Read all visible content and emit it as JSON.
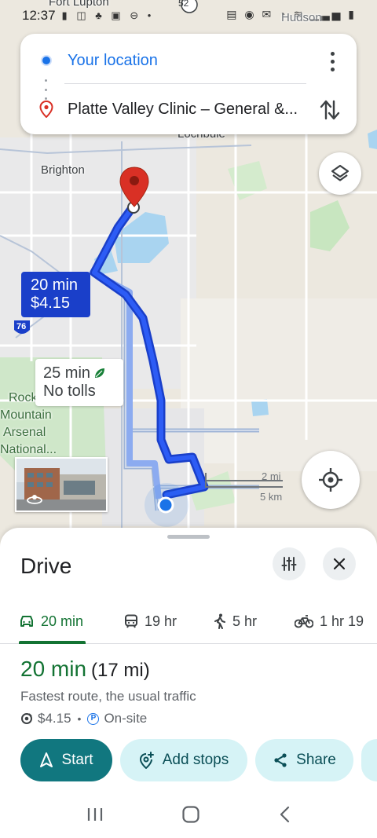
{
  "status_bar": {
    "time": "12:37",
    "carrier_text": "Hudson"
  },
  "search": {
    "origin": "Your location",
    "destination": "Platte Valley Clinic – General &..."
  },
  "map": {
    "labels": {
      "fort_lupton": "Fort Lupton",
      "lochbuie": "Lochbuie",
      "brighton": "Brighton",
      "rocky_mountain_arsenal": [
        "Rocky",
        "Mountain",
        "Arsenal",
        "National..."
      ],
      "highway_76": "76",
      "highway_52": "52",
      "hudson": "Hudson"
    },
    "primary_route": {
      "time": "20 min",
      "cost": "$4.15"
    },
    "alternate_route": {
      "time": "25 min",
      "note": "No tolls"
    },
    "scale": {
      "miles": "2 mi",
      "km": "5 km"
    }
  },
  "sheet": {
    "title": "Drive",
    "tabs": [
      {
        "icon": "car-icon",
        "label": "20 min",
        "active": true
      },
      {
        "icon": "transit-icon",
        "label": "19 hr",
        "active": false
      },
      {
        "icon": "walk-icon",
        "label": "5 hr",
        "active": false
      },
      {
        "icon": "bike-icon",
        "label": "1 hr 19",
        "active": false
      }
    ],
    "route": {
      "duration": "20 min",
      "distance": "(17 mi)",
      "description": "Fastest route, the usual traffic",
      "toll": "$4.15",
      "parking": "On-site"
    },
    "actions": {
      "start": "Start",
      "add_stops": "Add stops",
      "share": "Share"
    }
  },
  "colors": {
    "route_blue": "#1a3fc9",
    "accent_green": "#137333",
    "link_blue": "#1a73e8",
    "pin_red": "#d93025",
    "start_teal": "#11777f"
  }
}
